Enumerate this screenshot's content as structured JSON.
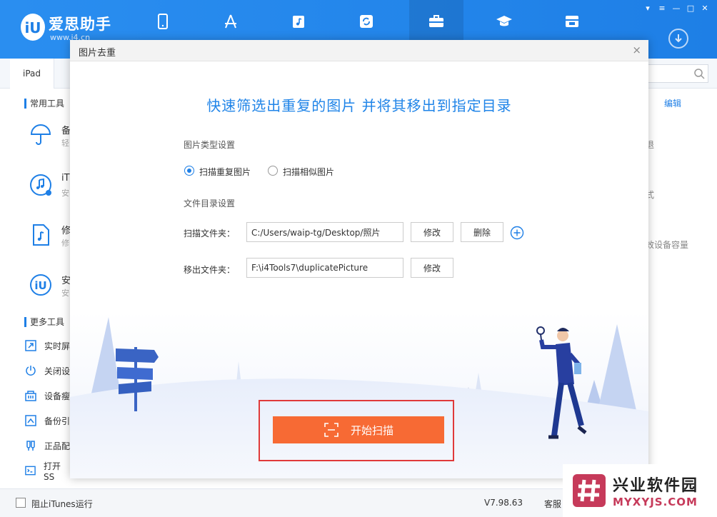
{
  "app": {
    "brand_name": "爱思助手",
    "brand_sub": "www.i4.cn"
  },
  "nav": {
    "items": [
      {
        "name": "my-device",
        "icon": "phone-icon"
      },
      {
        "name": "apps",
        "icon": "appstore-icon"
      },
      {
        "name": "ringtones",
        "icon": "music-icon"
      },
      {
        "name": "flash",
        "icon": "refresh-icon"
      },
      {
        "name": "toolbox",
        "icon": "toolbox-icon",
        "active": true
      },
      {
        "name": "tutorial",
        "icon": "graduation-cap-icon"
      },
      {
        "name": "store",
        "icon": "store-icon"
      }
    ]
  },
  "tabs": {
    "device": "iPad"
  },
  "sidebar": {
    "common_title": "常用工具",
    "more_title": "更多工具",
    "big_tools": [
      {
        "label": "备",
        "sub": "轻"
      },
      {
        "label": "iT",
        "sub": "安"
      },
      {
        "label": "修",
        "sub": "修"
      },
      {
        "label": "安",
        "sub": "安"
      }
    ],
    "more_tools": [
      {
        "label": "实时屏"
      },
      {
        "label": "关闭设"
      },
      {
        "label": "设备瘦"
      },
      {
        "label": "备份引"
      },
      {
        "label": "正品配"
      },
      {
        "label": "打开SS"
      }
    ]
  },
  "right_panel": {
    "edit": "编辑",
    "line1": "退",
    "line2": "式",
    "line3": "效设备容量"
  },
  "dialog": {
    "title": "图片去重",
    "close": "×",
    "headline": "快速筛选出重复的图片 并将其移出到指定目录",
    "type_section": "图片类型设置",
    "option_duplicate": "扫描重复图片",
    "option_similar": "扫描相似图片",
    "dir_section": "文件目录设置",
    "scan_label": "扫描文件夹：",
    "scan_value": "C:/Users/waip-tg/Desktop/照片",
    "modify": "修改",
    "delete": "删除",
    "move_label": "移出文件夹：",
    "move_value": "F:\\i4Tools7\\duplicatePicture",
    "start": "开始扫描"
  },
  "statusbar": {
    "block_itunes": "阻止iTunes运行",
    "version": "V7.98.63",
    "service": "客服"
  },
  "watermark": {
    "main": "兴业软件园",
    "sub": "MYXYJS.COM"
  },
  "colors": {
    "brand_blue": "#1e7fe6",
    "start_orange": "#f76a34",
    "highlight_red": "#e03a3a"
  }
}
